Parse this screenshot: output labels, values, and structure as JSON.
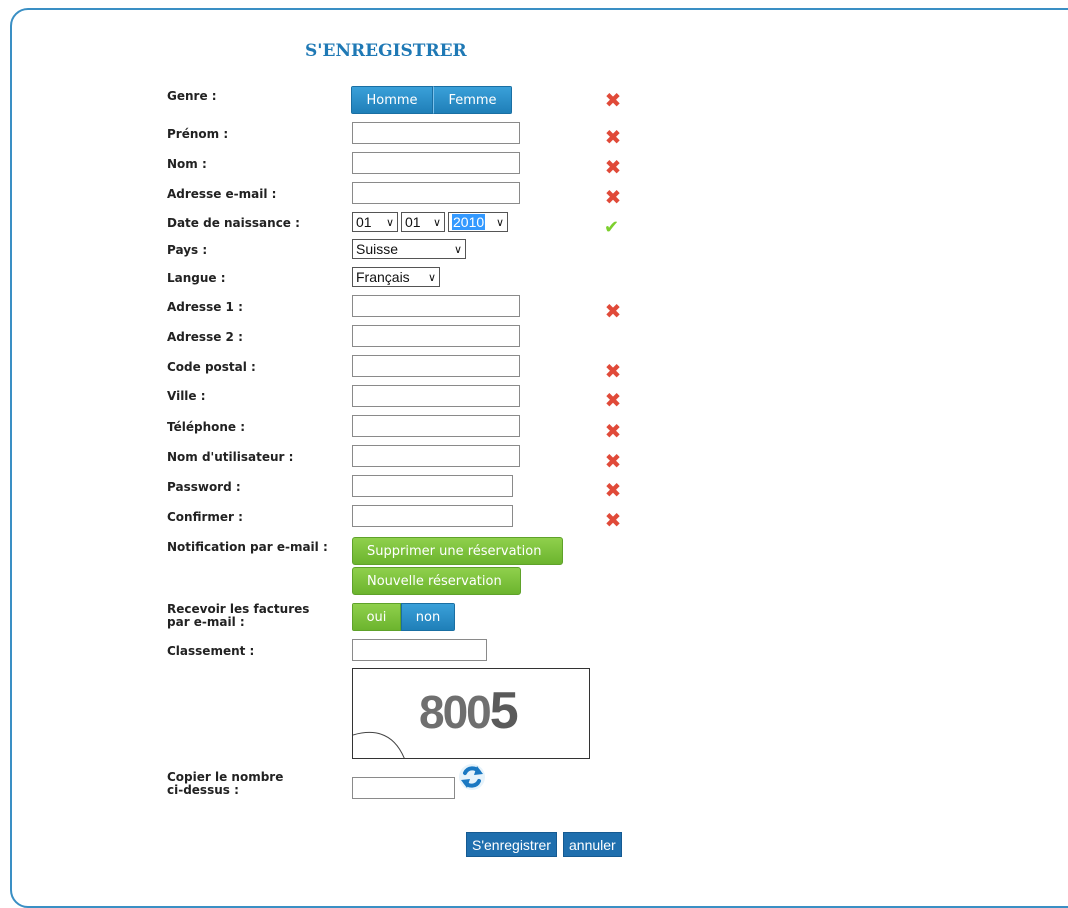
{
  "form": {
    "title": "S'ENREGISTRER",
    "labels": {
      "genre": "Genre :",
      "prenom": "Prénom :",
      "nom": "Nom :",
      "email": "Adresse e-mail :",
      "naissance": "Date de naissance :",
      "pays": "Pays :",
      "langue": "Langue :",
      "adresse1": "Adresse 1 :",
      "adresse2": "Adresse 2 :",
      "code_postal": "Code postal :",
      "ville": "Ville :",
      "telephone": "Téléphone :",
      "utilisateur": "Nom d'utilisateur :",
      "password": "Password :",
      "confirmer": "Confirmer :",
      "notification": "Notification par e-mail :",
      "factures_1": "Recevoir les factures",
      "factures_2": "par e-mail :",
      "classement": "Classement :",
      "copier_1": "Copier le nombre",
      "copier_2": "ci-dessus :"
    },
    "genre_options": [
      "Homme",
      "Femme"
    ],
    "date": {
      "day": "01",
      "month": "01",
      "year": "2010"
    },
    "pays_selected": "Suisse",
    "langue_selected": "Français",
    "notification_buttons": [
      "Supprimer une réservation",
      "Nouvelle réservation"
    ],
    "factures_options": [
      "oui",
      "non"
    ],
    "captcha_text": {
      "a": "80",
      "b": "0",
      "c": "5"
    },
    "submit_label": "S'enregistrer",
    "cancel_label": "annuler",
    "colors": {
      "accent": "#1f79b5",
      "error": "#e04a39",
      "ok": "#7ccf2d",
      "green": "#7cc23a"
    },
    "icons": {
      "error": "close-x-icon",
      "ok": "checkmark-icon",
      "refresh": "refresh-icon"
    }
  }
}
